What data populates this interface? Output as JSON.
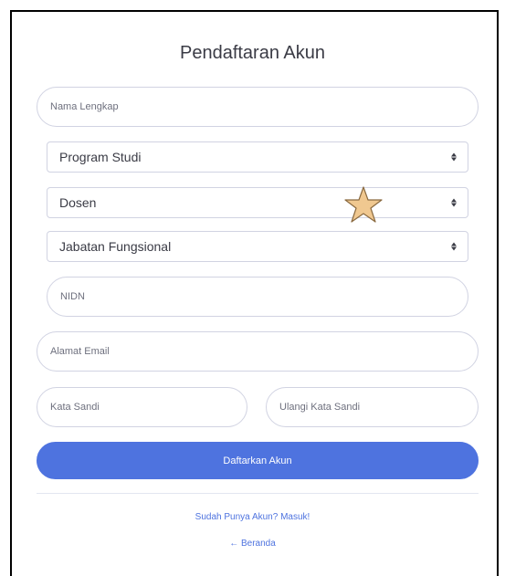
{
  "form": {
    "title": "Pendaftaran Akun",
    "full_name_placeholder": "Nama Lengkap",
    "program_select": "Program Studi",
    "role_select": "Dosen",
    "position_select": "Jabatan Fungsional",
    "nidn_placeholder": "NIDN",
    "email_placeholder": "Alamat Email",
    "password_placeholder": "Kata Sandi",
    "repeat_password_placeholder": "Ulangi Kata Sandi",
    "submit_label": "Daftarkan Akun"
  },
  "links": {
    "login": "Sudah Punya Akun? Masuk!",
    "home": "← Beranda"
  },
  "overlay": {
    "icon": "star-icon",
    "color": "#f0c890"
  },
  "colors": {
    "primary": "#4e73df",
    "border": "#d1d3e2",
    "text": "#3a3b45"
  }
}
